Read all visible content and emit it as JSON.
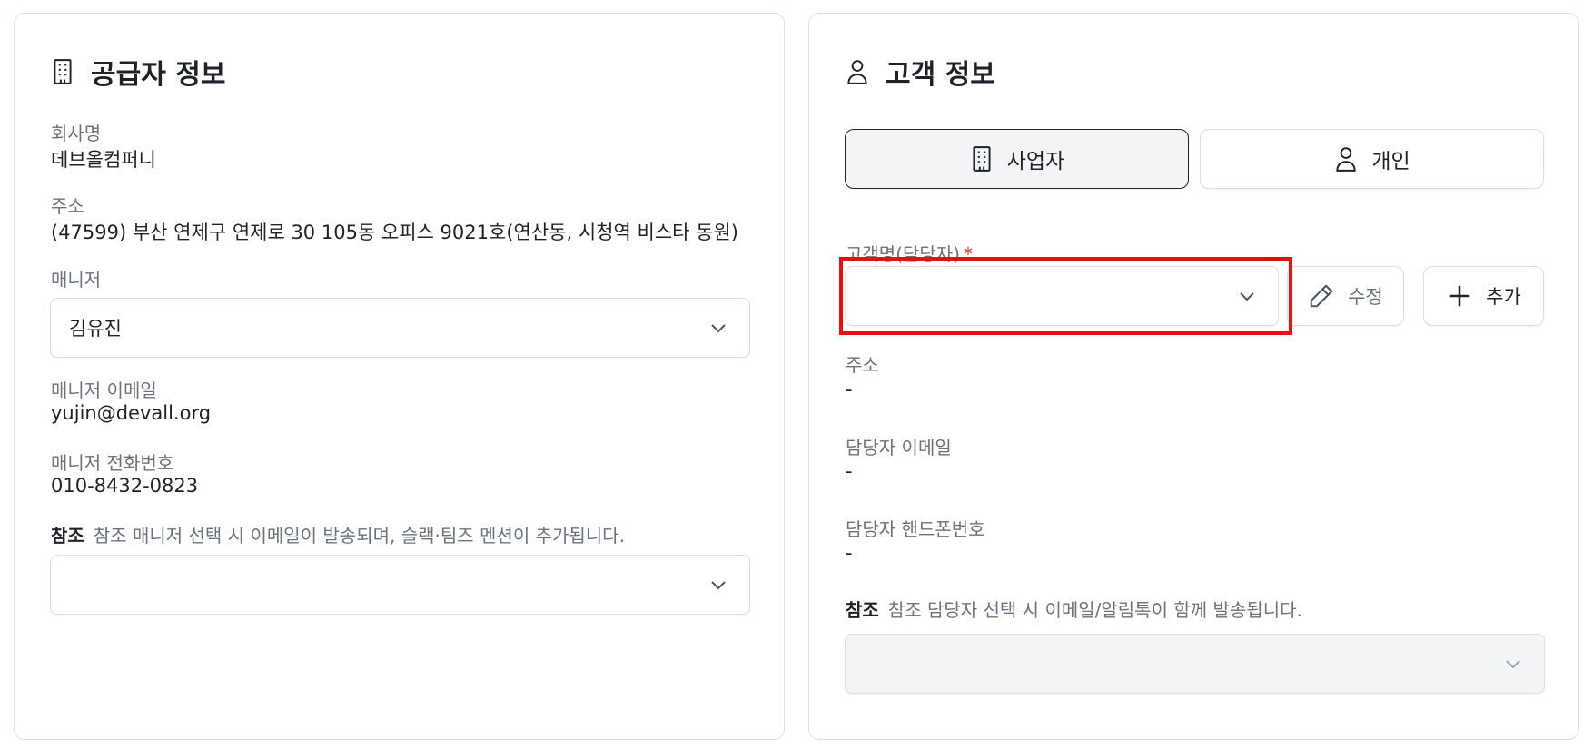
{
  "supplier": {
    "title": "공급자 정보",
    "company_label": "회사명",
    "company_value": "데브올컴퍼니",
    "address_label": "주소",
    "address_value": "(47599) 부산 연제구 연제로 30 105동 오피스 9021호(연산동, 시청역 비스타 동원)",
    "manager_label": "매니저",
    "manager_value": "김유진",
    "manager_email_label": "매니저 이메일",
    "manager_email_value": "yujin@devall.org",
    "manager_phone_label": "매니저 전화번호",
    "manager_phone_value": "010-8432-0823",
    "ref_label": "참조",
    "ref_note": "참조 매니저 선택 시 이메일이 발송되며, 슬랙·팀즈 멘션이 추가됩니다.",
    "ref_value": ""
  },
  "customer": {
    "title": "고객 정보",
    "type_business": "사업자",
    "type_individual": "개인",
    "name_label": "고객명(담당자)",
    "required_mark": "*",
    "name_value": "",
    "edit_button": "수정",
    "add_button": "추가",
    "address_label": "주소",
    "address_value": "-",
    "email_label": "담당자 이메일",
    "email_value": "-",
    "phone_label": "담당자 핸드폰번호",
    "phone_value": "-",
    "ref_label": "참조",
    "ref_note": "참조 담당자 선택 시 이메일/알림톡이 함께 발송됩니다.",
    "ref_value": ""
  },
  "icons": {
    "building": "building-icon",
    "person": "person-icon",
    "chevron": "chevron-down-icon",
    "pencil": "pencil-icon",
    "plus": "plus-icon"
  },
  "colors": {
    "highlight": "#e61010",
    "required": "#e5341a",
    "active_toggle_bg": "#f3f4f6"
  }
}
